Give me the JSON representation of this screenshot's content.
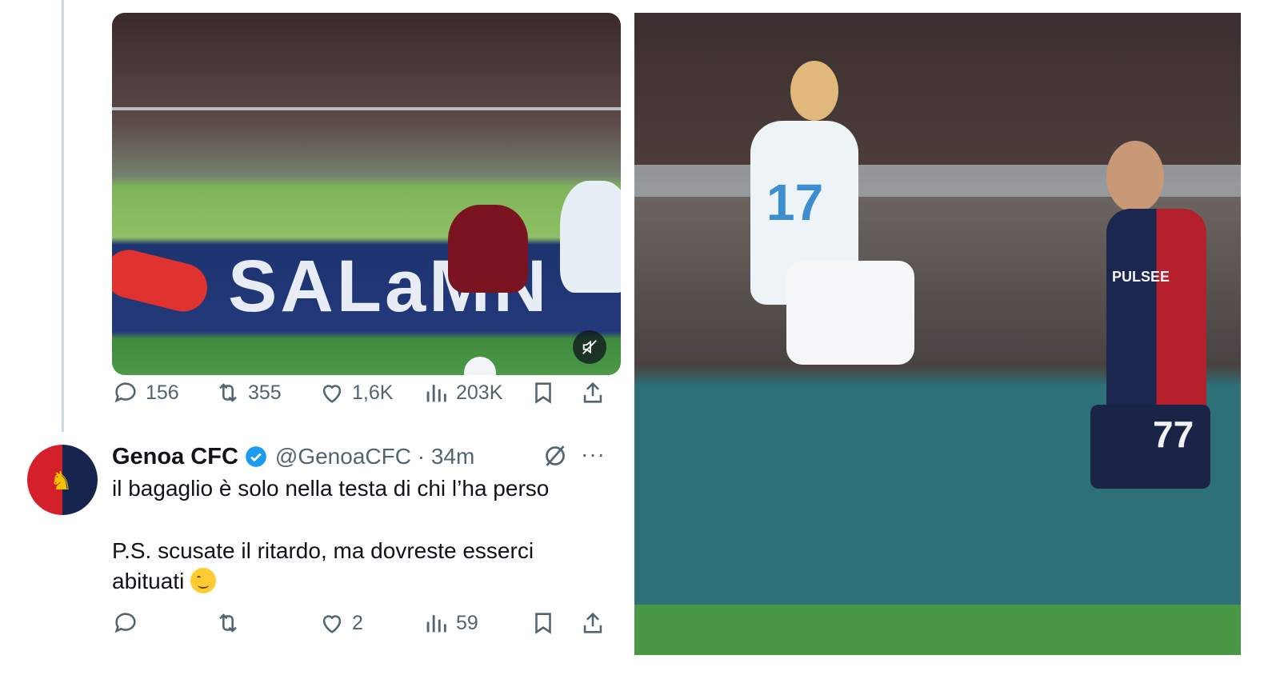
{
  "previous_tweet": {
    "media_board_text": "SALaMN",
    "player_number": "77",
    "stats": {
      "replies": "156",
      "reposts": "355",
      "likes": "1,6K",
      "views": "203K"
    }
  },
  "reply_tweet": {
    "author_name": "Genoa CFC",
    "handle_time": "@GenoaCFC · 34m",
    "text_line1": "il bagaglio è solo nella testa di chi l’ha perso",
    "text_line2": "P.S. scusate il ritardo, ma dovreste esserci abituati",
    "stats": {
      "replies": "",
      "reposts": "",
      "likes": "2",
      "views": "59"
    }
  },
  "photo": {
    "jumper_number": "17",
    "genoa_number": "77",
    "genoa_sponsor": "PULSEE"
  },
  "colors": {
    "icon_gray": "#536471",
    "verified_blue": "#1d9bf0",
    "genoa_red": "#d4202a",
    "genoa_blue": "#16254d"
  },
  "icons": [
    "reply-icon",
    "repost-icon",
    "like-icon",
    "views-icon",
    "bookmark-icon",
    "share-icon",
    "mute-icon",
    "verified-icon",
    "grok-icon",
    "more-icon"
  ]
}
